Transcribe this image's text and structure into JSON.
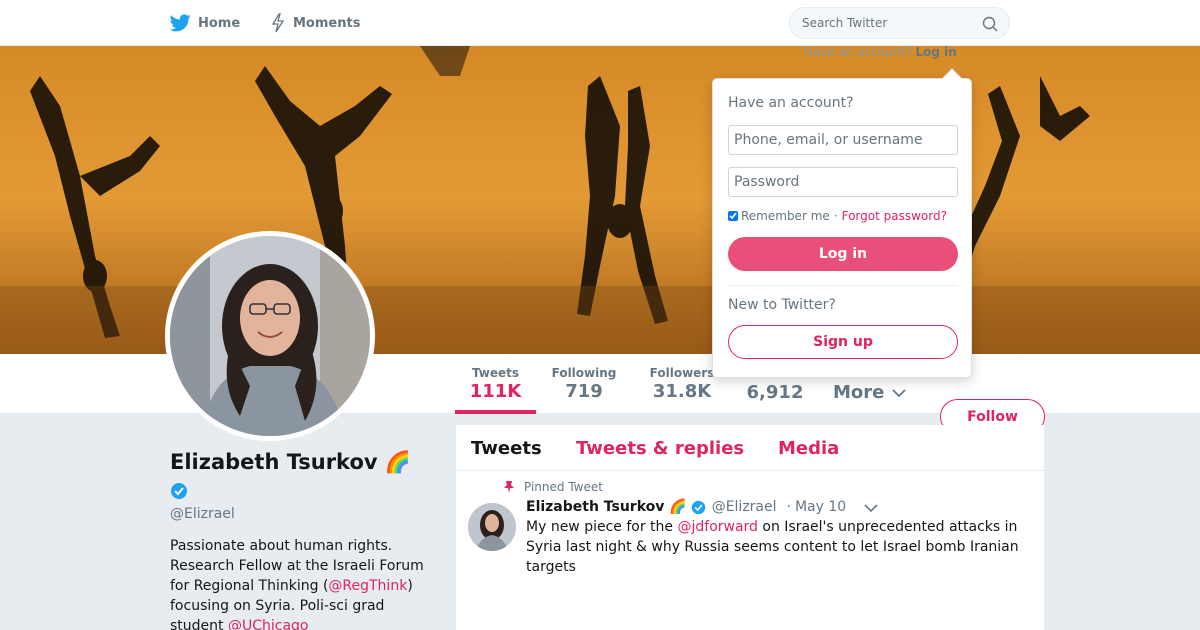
{
  "nav": {
    "home_label": "Home",
    "moments_label": "Moments",
    "search_placeholder": "Search Twitter",
    "have_account_prompt": "Have an account?",
    "login_link": "Log in",
    "brand_color": "#1da1f2"
  },
  "profile_nav": {
    "stats": [
      {
        "label": "Tweets",
        "value": "111K"
      },
      {
        "label": "Following",
        "value": "719"
      },
      {
        "label": "Followers",
        "value": "31.8K"
      },
      {
        "label": "",
        "value": "6,912"
      }
    ],
    "more_label": "More",
    "follow_label": "Follow",
    "accent_color": "#e0245e"
  },
  "profile": {
    "name": "Elizabeth Tsurkov 🌈",
    "handle": "@Elizrael",
    "bio": {
      "line1": "Passionate about human rights. Research Fellow at the Israeli Forum for Regional Thinking (",
      "link1": "@RegThink",
      "line2": ") focusing on Syria. Poli-sci grad student ",
      "link2": "@UChicago"
    }
  },
  "timeline": {
    "tabs": [
      "Tweets",
      "Tweets & replies",
      "Media"
    ],
    "pinned_label": "Pinned Tweet",
    "tweet": {
      "name": "Elizabeth Tsurkov 🌈",
      "handle": "@Elizrael",
      "dot": "·",
      "date": "May 10",
      "text_before": "My new piece for the ",
      "mention": "@jdforward",
      "text_after": " on Israel's unprecedented attacks in Syria last night & why Russia seems content to let Israel bomb Iranian targets"
    }
  },
  "login_dropdown": {
    "title": "Have an account?",
    "username_placeholder": "Phone, email, or username",
    "password_placeholder": "Password",
    "remember_label": "Remember me",
    "separator": "·",
    "forgot_label": "Forgot password?",
    "login_button": "Log in",
    "new_prompt": "New to Twitter?",
    "signup_button": "Sign up"
  }
}
